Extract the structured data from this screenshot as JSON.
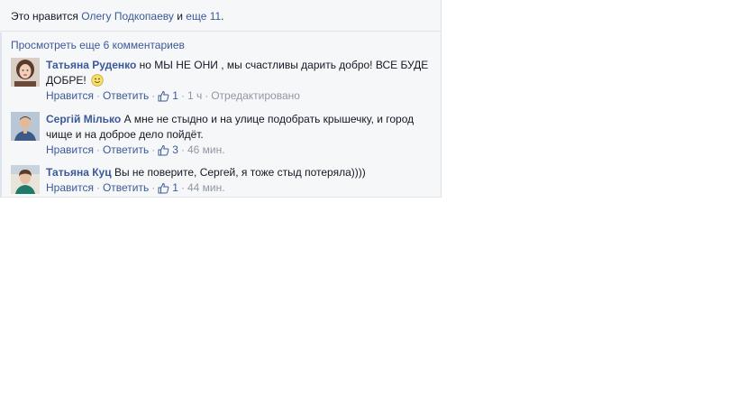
{
  "likes": {
    "prefix": "Это нравится",
    "person": "Олегу Подкопаеву",
    "conj": "и",
    "others": "еще 11",
    "suffix": "."
  },
  "more_comments": "Просмотреть еще 6 комментариев",
  "comments": [
    {
      "author": "Татьяна Руденко",
      "text": "но МЫ НЕ ОНИ , мы счастливы дарить добро! ВСЕ БУДЕ ДОБРЕ!",
      "like_label": "Нравится",
      "reply_label": "Ответить",
      "likes": "1",
      "time": "1 ч",
      "edited": "Отредактировано"
    },
    {
      "author": "Сергій Мілько",
      "text": "А мне не стыдно и на улице подобрать крышечку, и город чище и на доброе дело пойдёт.",
      "like_label": "Нравится",
      "reply_label": "Ответить",
      "likes": "3",
      "time": "46 мин."
    },
    {
      "author": "Татьяна Куц",
      "text": "Вы не поверите, Сергей, я тоже стыд потеряла))))",
      "like_label": "Нравится",
      "reply_label": "Ответить",
      "likes": "1",
      "time": "44 мин."
    }
  ],
  "separator": "·",
  "colors": {
    "link": "#3b5998",
    "meta": "#9197a3",
    "panel": "#f6f7f9"
  }
}
